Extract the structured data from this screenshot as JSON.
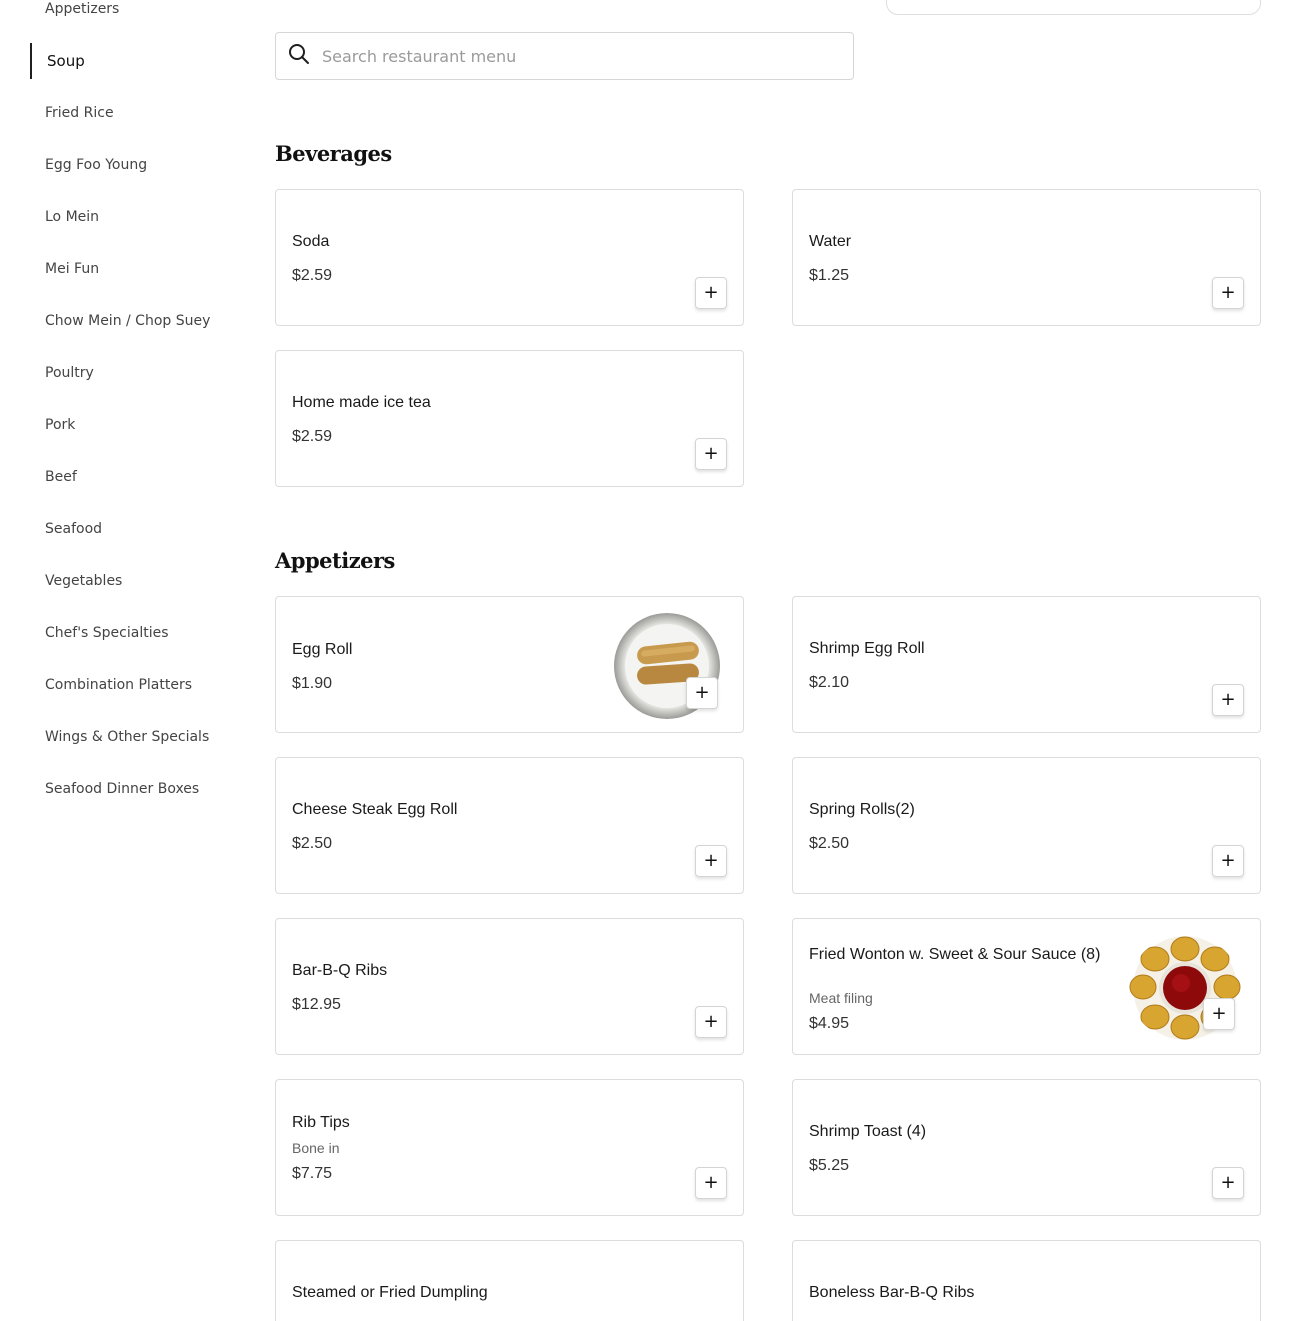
{
  "sidebar": {
    "items": [
      {
        "label": "Appetizers"
      },
      {
        "label": "Soup",
        "active": true
      },
      {
        "label": "Fried Rice"
      },
      {
        "label": "Egg Foo Young"
      },
      {
        "label": "Lo Mein"
      },
      {
        "label": "Mei Fun"
      },
      {
        "label": "Chow Mein / Chop Suey"
      },
      {
        "label": "Poultry"
      },
      {
        "label": "Pork"
      },
      {
        "label": "Beef"
      },
      {
        "label": "Seafood"
      },
      {
        "label": "Vegetables"
      },
      {
        "label": "Chef's Specialties"
      },
      {
        "label": "Combination Platters"
      },
      {
        "label": "Wings & Other Specials"
      },
      {
        "label": "Seafood Dinner Boxes"
      }
    ]
  },
  "search": {
    "placeholder": "Search restaurant menu",
    "icon": "search-icon"
  },
  "sections": [
    {
      "title": "Beverages",
      "items": [
        {
          "name": "Soda",
          "price": "$2.59"
        },
        {
          "name": "Water",
          "price": "$1.25"
        },
        {
          "name": "Home made ice tea",
          "price": "$2.59"
        }
      ]
    },
    {
      "title": "Appetizers",
      "items": [
        {
          "name": "Egg Roll",
          "price": "$1.90",
          "image": "egg-roll-photo"
        },
        {
          "name": "Shrimp Egg Roll",
          "price": "$2.10"
        },
        {
          "name": "Cheese Steak Egg Roll",
          "price": "$2.50"
        },
        {
          "name": "Spring Rolls(2)",
          "price": "$2.50"
        },
        {
          "name": "Bar-B-Q Ribs",
          "price": "$12.95"
        },
        {
          "name": "Fried Wonton w. Sweet & Sour Sauce (8)",
          "desc": "Meat filing",
          "price": "$4.95",
          "image": "fried-wonton-photo"
        },
        {
          "name": "Rib Tips",
          "desc": "Bone in",
          "price": "$7.75"
        },
        {
          "name": "Shrimp Toast (4)",
          "price": "$5.25"
        },
        {
          "name": "Steamed or Fried Dumpling"
        },
        {
          "name": "Boneless Bar-B-Q Ribs"
        }
      ]
    }
  ],
  "add_button_label": "+"
}
